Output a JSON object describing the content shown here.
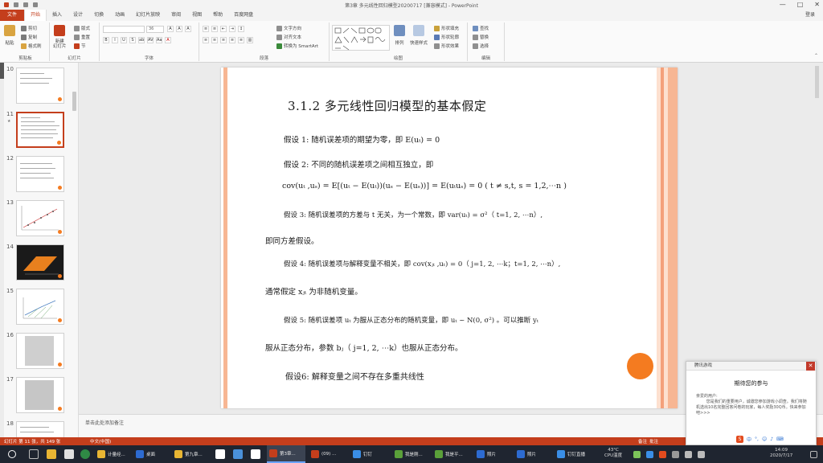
{
  "window": {
    "title": "第3章  多元线性回归模型20200717 [兼容模式] - PowerPoint",
    "login": "登录",
    "controls": [
      "—",
      "□",
      "✕"
    ]
  },
  "ribbon_tabs": [
    "文件",
    "开始",
    "插入",
    "设计",
    "切换",
    "动画",
    "幻灯片放映",
    "审阅",
    "视图",
    "帮助",
    "百度网盘"
  ],
  "ribbon": {
    "clipboard": {
      "paste": "粘贴",
      "cut": "剪切",
      "copy": "复制",
      "format_painter": "格式刷",
      "label": "剪贴板"
    },
    "slides": {
      "new_slide": "新建\n幻灯片",
      "layout": "版式",
      "reset": "重置",
      "section": "节",
      "label": "幻灯片"
    },
    "font": {
      "label": "字体",
      "size": "36"
    },
    "paragraph": {
      "text_direction": "文字方向",
      "align_text": "对齐文本",
      "smartart": "转换为 SmartArt",
      "label": "段落"
    },
    "drawing": {
      "arrange": "排列",
      "quick_styles": "快速样式",
      "fill": "形状填充",
      "outline": "形状轮廓",
      "effects": "形状效果",
      "label": "绘图"
    },
    "editing": {
      "find": "查找",
      "replace": "替换",
      "select": "选择",
      "label": "编辑"
    }
  },
  "thumbnails": [
    {
      "num": "10",
      "type": "text"
    },
    {
      "num": "11",
      "type": "text",
      "selected": true
    },
    {
      "num": "12",
      "type": "text"
    },
    {
      "num": "13",
      "type": "chart"
    },
    {
      "num": "14",
      "type": "dark"
    },
    {
      "num": "15",
      "type": "chart2"
    },
    {
      "num": "16",
      "type": "scan"
    },
    {
      "num": "17",
      "type": "scan"
    },
    {
      "num": "18",
      "type": "text"
    }
  ],
  "slide": {
    "title": "3.1.2    多元线性回归模型的基本假定",
    "a1": "假设 1:      随机误差项的期望为零，即 E(uₜ) = 0",
    "a2": "假设 2:      不同的随机误差项之间相互独立，即",
    "a2_formula": "cov(uₜ ,uₛ) = E[(uₜ − E(uₜ))(uₛ − E(uₛ))] = E(uₜuₛ) = 0     ( t ≠ s,t, s = 1,2,⋯n )",
    "a3": "假设 3:      随机误差项的方差与 t 无关，为一个常数，即 var(uₜ) = σ²（ t=1, 2, ⋯n）,",
    "a3_cont": "即同方差假设。",
    "a4": "假设 4:      随机误差项与解释变量不相关，即 cov(xⱼₜ ,uₜ) = 0（ j=1, 2, ⋯k；t=1, 2, ⋯n）,",
    "a4_cont": "通常假定 xⱼₜ 为非随机变量。",
    "a5": "假设 5:      随机误差项 uₜ 为服从正态分布的随机变量，即 uₜ ~ N(0, σ²) 。可以推断 yₜ",
    "a5_cont": "服从正态分布，参数 bⱼ（ j=1, 2, ⋯k）也服从正态分布。",
    "a6": "假设6:      解释变量之间不存在多重共线性"
  },
  "notes_placeholder": "单击此处添加备注",
  "status": {
    "slide_info": "幻灯片 第 11 张，共 149 张",
    "language": "中文(中国)",
    "notes": "备注",
    "comments": "批注"
  },
  "popup": {
    "header": "腾讯游戏",
    "title": "期待您的参与",
    "body": "亲爱的用户:\n        您是我们的重要用户，诚邀您参加游戏小调查。我们将随机选出10名完整回答问卷的玩家，每人奖励30Q币。快来参加吧>>>",
    "close": "✕"
  },
  "taskbar": {
    "apps": [
      {
        "label": "计量经...",
        "color": "#e8b533"
      },
      {
        "label": "桌面",
        "color": "#2d6bd1"
      },
      {
        "label": "第九章...",
        "color": "#e8b533"
      },
      {
        "label": "第3章...",
        "color": "#c43e1c",
        "active": true
      },
      {
        "label": "(09) ...",
        "color": "#c43e1c"
      },
      {
        "label": "钉钉",
        "color": "#3a8ee6"
      },
      {
        "label": "我是刚...",
        "color": "#5aa03a"
      },
      {
        "label": "我是平...",
        "color": "#5aa03a"
      },
      {
        "label": "照片",
        "color": "#2d6bd1"
      },
      {
        "label": "照片",
        "color": "#2d6bd1"
      },
      {
        "label": "钉钉直播",
        "color": "#3a8ee6"
      }
    ],
    "cpu_temp": "43°C",
    "cpu_label": "CPU温度",
    "time": "14:09",
    "date": "2020/7/17"
  }
}
